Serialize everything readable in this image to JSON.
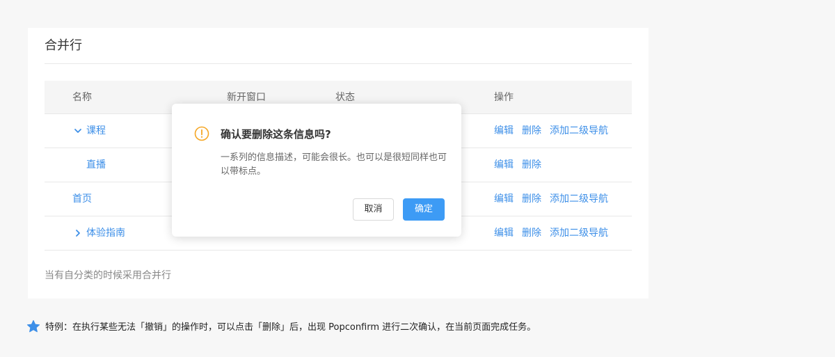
{
  "card": {
    "title": "合并行",
    "footnote": "当有自分类的时候采用合并行"
  },
  "table": {
    "headers": [
      "名称",
      "新开窗口",
      "状态",
      "操作"
    ],
    "rows": [
      {
        "name": "课程",
        "expander": "chevron-down-icon",
        "new_window": "",
        "status": "",
        "actions": [
          "编辑",
          "删除",
          "添加二级导航"
        ]
      },
      {
        "name": "直播",
        "expander": "",
        "new_window": "",
        "status": "",
        "actions": [
          "编辑",
          "删除"
        ]
      },
      {
        "name": "首页",
        "expander": "",
        "new_window": "",
        "status": "",
        "actions": [
          "编辑",
          "删除",
          "添加二级导航"
        ]
      },
      {
        "name": "体验指南",
        "expander": "chevron-right-icon",
        "new_window": "",
        "status": "",
        "actions": [
          "编辑",
          "删除",
          "添加二级导航"
        ]
      }
    ]
  },
  "popconfirm": {
    "icon": "warning-circle-icon",
    "title": "确认要删除这条信息吗?",
    "description": "一系列的信息描述，可能会很长。也可以是很短同样也可以带标点。",
    "cancel_label": "取消",
    "ok_label": "确定"
  },
  "tip": {
    "icon": "star-icon",
    "text": "特例：在执行某些无法「撤销」的操作时，可以点击「删除」后，出现 Popconfirm 进行二次确认，在当前页面完成任务。"
  },
  "colors": {
    "link": "#3d8fe8",
    "primary": "#3d9bf5",
    "warning": "#f5a623",
    "background": "#f7f7f7"
  }
}
